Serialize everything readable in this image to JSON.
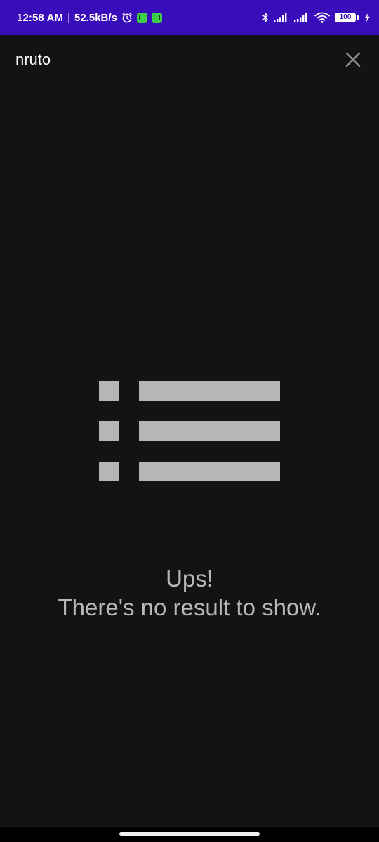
{
  "status_bar": {
    "time": "12:58 AM",
    "separator": "|",
    "network_speed": "52.5kB/s",
    "battery_level": "100",
    "icons": [
      "alarm-icon",
      "app-notification-icon",
      "app-notification-icon",
      "bluetooth-icon",
      "signal-icon",
      "signal-icon",
      "wifi-icon",
      "battery-icon",
      "charging-icon"
    ],
    "background_color": "#3a0dbb"
  },
  "toolbar": {
    "search_query": "nruto",
    "close_icon": "close-icon"
  },
  "empty_state": {
    "icon": "list-icon",
    "title": "Ups!",
    "message": "There's no result to show."
  },
  "colors": {
    "background": "#131313",
    "empty_text": "#b8b8b8",
    "icon_fill": "#b6b6b6"
  }
}
